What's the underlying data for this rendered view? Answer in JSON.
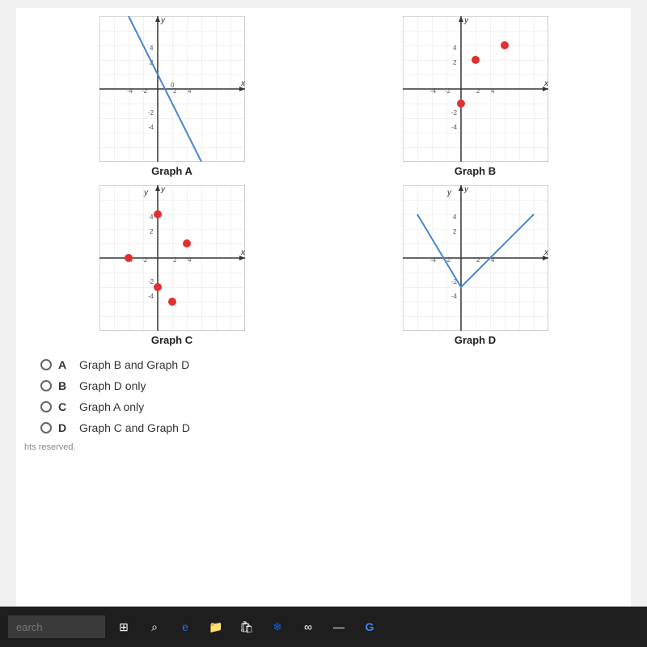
{
  "graphs": [
    {
      "id": "graph-a",
      "label": "Graph A",
      "type": "line",
      "description": "Diagonal line from top-left to bottom-right through origin area"
    },
    {
      "id": "graph-b",
      "label": "Graph B",
      "type": "points",
      "description": "Scattered red dots"
    },
    {
      "id": "graph-c",
      "label": "Graph C",
      "type": "points",
      "description": "Scattered red dots"
    },
    {
      "id": "graph-d",
      "label": "Graph D",
      "type": "v-shape",
      "description": "V-shaped blue line"
    }
  ],
  "options": [
    {
      "letter": "A",
      "text": "Graph B and Graph D"
    },
    {
      "letter": "B",
      "text": "Graph D only"
    },
    {
      "letter": "C",
      "text": "Graph A only"
    },
    {
      "letter": "D",
      "text": "Graph C and Graph D"
    }
  ],
  "copyright": "hts reserved.",
  "taskbar": {
    "search_placeholder": "earch",
    "icons": [
      "⊞",
      "e",
      "📁",
      "🎒",
      "❄",
      "∞",
      "—",
      "G"
    ]
  }
}
